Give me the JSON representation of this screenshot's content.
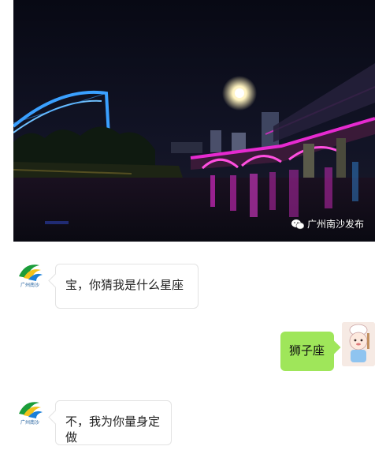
{
  "photo": {
    "watermark_text": "广州南沙发布",
    "watermark_icon": "wechat-icon"
  },
  "messages": [
    {
      "side": "left",
      "avatar": "nansha-logo-avatar",
      "text": "宝，你猜我是什么星座"
    },
    {
      "side": "right",
      "avatar": "cartoon-chef-avatar",
      "text": "狮子座"
    },
    {
      "side": "left",
      "avatar": "nansha-logo-avatar",
      "text": "不，我为你量身定做"
    }
  ],
  "colors": {
    "right_bubble": "#9fe65a",
    "left_bubble_border": "#e3e3e3",
    "bridge_light": "#e62ad0",
    "arch_light": "#3aa0ff"
  }
}
